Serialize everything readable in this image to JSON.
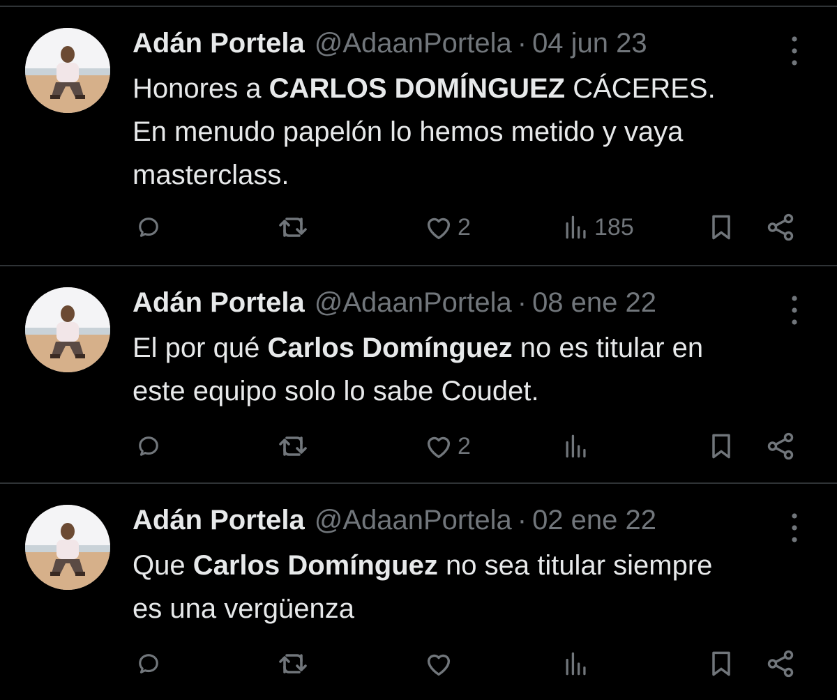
{
  "colors": {
    "background": "#000000",
    "text": "#e7e9ea",
    "muted": "#71767b",
    "divider": "#2f3336"
  },
  "tweets": [
    {
      "name": "Adán Portela",
      "handle": "@AdaanPortela",
      "separator": "·",
      "date": "04 jun 23",
      "text_parts": [
        "Honores a ",
        "CARLOS DOMÍNGUEZ",
        " CÁCERES.",
        "En menudo papelón lo hemos metido y vaya",
        "masterclass."
      ],
      "likes": "2",
      "views": "185",
      "icons": [
        "reply-icon",
        "retweet-icon",
        "like-icon",
        "views-icon",
        "bookmark-icon",
        "share-icon",
        "more-icon"
      ]
    },
    {
      "name": "Adán Portela",
      "handle": "@AdaanPortela",
      "separator": "·",
      "date": "08 ene 22",
      "text_parts": [
        "El por qué ",
        "Carlos Domínguez",
        " no es titular en",
        "este equipo solo lo sabe Coudet."
      ],
      "likes": "2",
      "views": "",
      "icons": [
        "reply-icon",
        "retweet-icon",
        "like-icon",
        "views-icon",
        "bookmark-icon",
        "share-icon",
        "more-icon"
      ]
    },
    {
      "name": "Adán Portela",
      "handle": "@AdaanPortela",
      "separator": "·",
      "date": "02 ene 22",
      "text_parts": [
        "Que ",
        "Carlos Domínguez",
        " no sea titular siempre",
        "es una vergüenza"
      ],
      "likes": "",
      "views": "",
      "icons": [
        "reply-icon",
        "retweet-icon",
        "like-icon",
        "views-icon",
        "bookmark-icon",
        "share-icon",
        "more-icon"
      ]
    }
  ]
}
